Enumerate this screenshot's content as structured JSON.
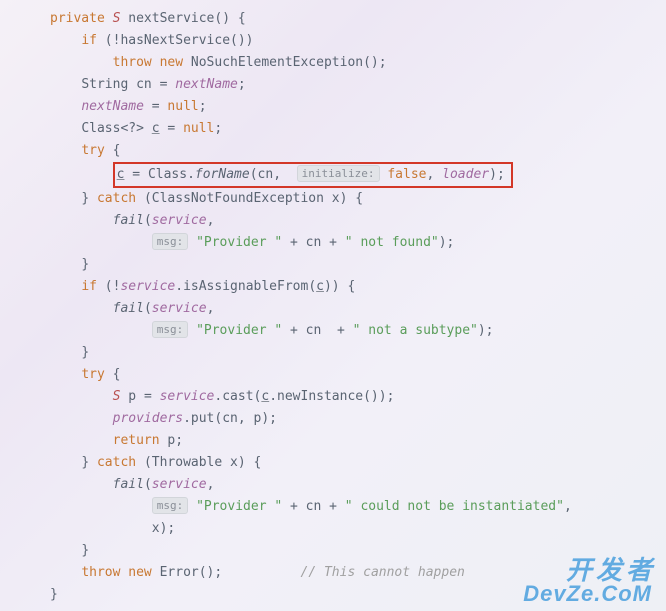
{
  "code": {
    "kw_private": "private",
    "ret_type": "S",
    "method_name": "nextService",
    "kw_if": "if",
    "kw_throw": "throw",
    "kw_new": "new",
    "kw_try": "try",
    "kw_catch": "catch",
    "kw_null": "null",
    "kw_return": "return",
    "kw_false": "false",
    "hasNextService": "hasNextService",
    "NoSuchElementException": "NoSuchElementException",
    "String": "String",
    "cn": "cn",
    "nextName": "nextName",
    "Class": "Class",
    "wildcard": "?",
    "var_c": "c",
    "forName": "forName",
    "hint_initialize": "initialize:",
    "loader": "loader",
    "ClassNotFoundException": "ClassNotFoundException",
    "var_x": "x",
    "fail": "fail",
    "service": "service",
    "hint_msg": "msg:",
    "str_provider": "\"Provider \"",
    "str_not_found": "\" not found\"",
    "isAssignableFrom": "isAssignableFrom",
    "str_not_subtype": "\" not a subtype\"",
    "var_p": "p",
    "cast": "cast",
    "newInstance": "newInstance",
    "providers": "providers",
    "put": "put",
    "Throwable": "Throwable",
    "str_not_inst": "\" could not be instantiated\"",
    "Error": "Error",
    "comment": "// This cannot happen"
  },
  "watermark": {
    "cn": "开发者",
    "en": "DevZe.CoM"
  }
}
